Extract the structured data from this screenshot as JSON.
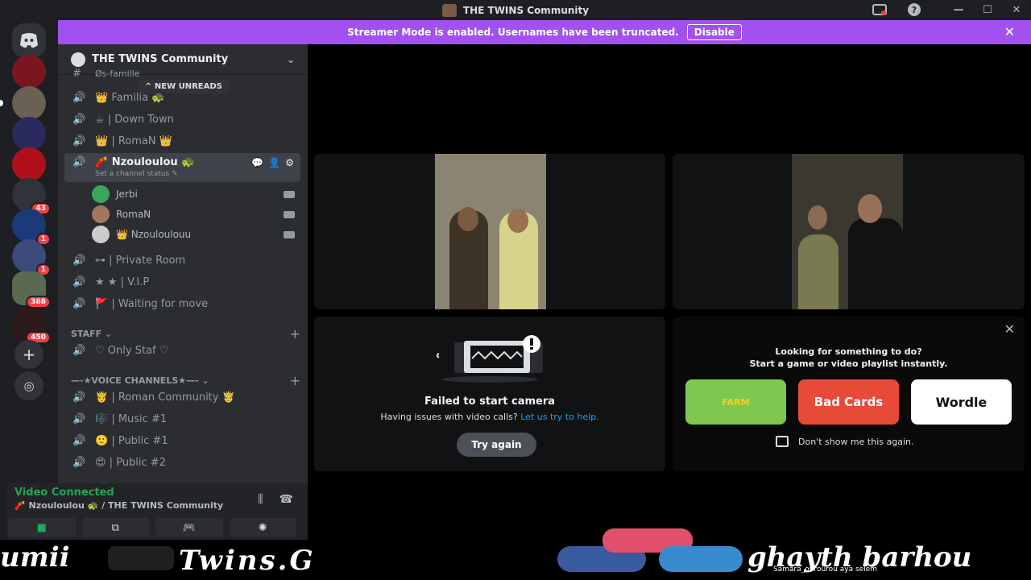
{
  "window": {
    "title": "THE TWINS Community",
    "controls": [
      "—",
      "☐",
      "✕"
    ]
  },
  "banner": {
    "text": "Streamer Mode is enabled. Usernames have been truncated.",
    "button": "Disable",
    "close": "✕"
  },
  "guilds": [
    {
      "name": "home",
      "badge": null
    },
    {
      "name": "server-1",
      "badge": null
    },
    {
      "name": "server-2",
      "badge": null
    },
    {
      "name": "server-3",
      "badge": null
    },
    {
      "name": "server-4",
      "badge": null
    },
    {
      "name": "server-5",
      "badge": "43"
    },
    {
      "name": "server-6",
      "badge": "1"
    },
    {
      "name": "server-7",
      "badge": "1"
    },
    {
      "name": "server-8",
      "badge": "388"
    },
    {
      "name": "server-9",
      "badge": "450"
    }
  ],
  "server": {
    "name": "THE TWINS Community",
    "new_unreads": "NEW UNREADS",
    "hidden_channel": "Øs-famille"
  },
  "channels": [
    {
      "label": "👑 Familia 🐢"
    },
    {
      "label": "☕ | Down Town"
    },
    {
      "label": "👑 | RomaN 👑"
    }
  ],
  "active_channel": {
    "label": "🧨 Nzouloulou 🐢",
    "status": "Set a channel status ✎"
  },
  "voice_users": [
    {
      "name": "Jerbi",
      "color": "#3ba55d"
    },
    {
      "name": "RomaN",
      "color": "#a07860"
    },
    {
      "name": "👑 Nzouloulouu",
      "color": "#cccccc"
    }
  ],
  "channels_after": [
    {
      "label": "⊶ | Private Room"
    },
    {
      "label": "★ ★ | V.I.P"
    },
    {
      "label": "🚩 | Waiting for move"
    }
  ],
  "category_staff": {
    "label": "STAFF ⌄",
    "plus": "+"
  },
  "staff_channels": [
    {
      "label": "♡ Only Staf ♡"
    }
  ],
  "category_voice": {
    "label": "—-★VOICE CHANNELS★—- ⌄",
    "plus": "+"
  },
  "voice_channels": [
    {
      "label": "🤴 | Roman Community 🤴"
    },
    {
      "label": "🎼 | Music #1"
    },
    {
      "label": "🙂 | Public #1"
    },
    {
      "label": "😍 | Public #2"
    }
  ],
  "voice_panel": {
    "status": "Video Connected",
    "location": "🧨 Nzouloulou 🐢 / THE TWINS Community"
  },
  "camera_fail": {
    "title": "Failed to start camera",
    "subtitle": "Having issues with video calls?",
    "link": "Let us try to help.",
    "button": "Try again"
  },
  "activity": {
    "line1": "Looking for something to do?",
    "line2": "Start a game or video playlist instantly.",
    "games": [
      "FARM",
      "Bad Cards",
      "Wordle"
    ],
    "checkbox": "Don't show me this again."
  },
  "stream_overlay": {
    "left_text": "umii",
    "middle_text": "Twins.G",
    "right_text": "ghayth barhou",
    "ticker": "Samara_ourourou aya selem"
  }
}
